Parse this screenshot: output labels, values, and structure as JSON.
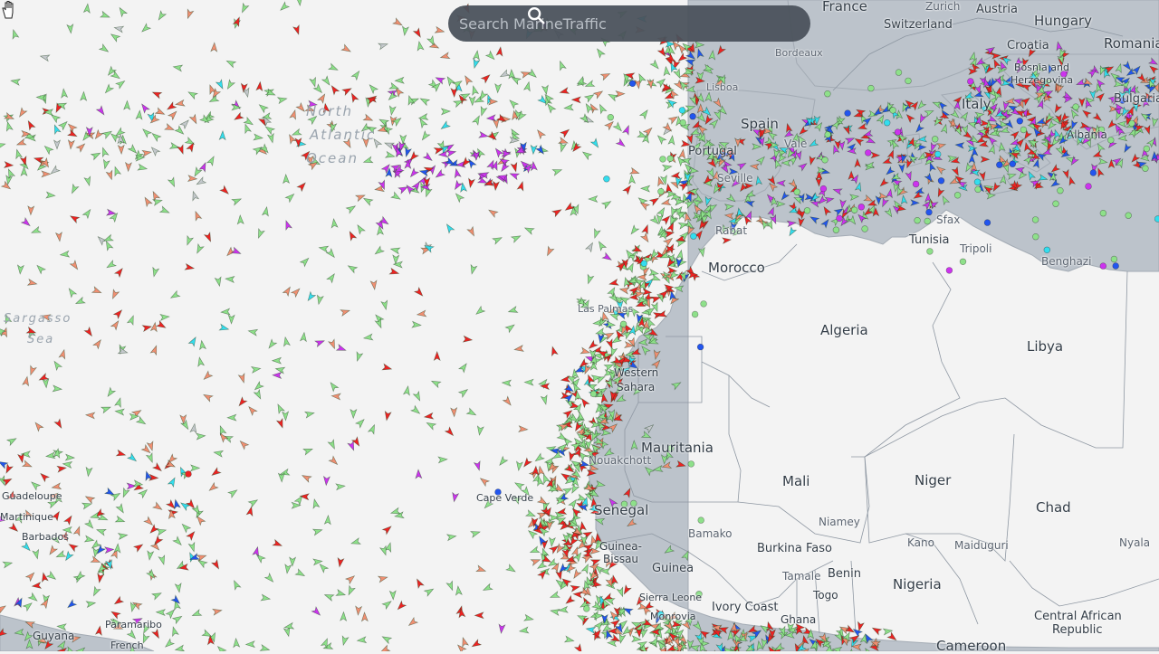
{
  "search": {
    "placeholder": "Search MarineTraffic"
  },
  "ocean_labels": {
    "north_atlantic_1": "North",
    "north_atlantic_2": "Atlantic",
    "north_atlantic_3": "Ocean",
    "sargasso_1": "Sargasso",
    "sargasso_2": "Sea"
  },
  "countries": {
    "france": "France",
    "switzerland": "Switzerland",
    "austria": "Austria",
    "hungary": "Hungary",
    "croatia": "Croatia",
    "romania": "Romania",
    "bosnia_1": "Bosnia and",
    "bosnia_2": "Herzegovina",
    "bulgaria": "Bulgaria",
    "italy": "Italy",
    "spain": "Spain",
    "portugal": "Portugal",
    "morocco": "Morocco",
    "algeria": "Algeria",
    "libya": "Libya",
    "tunisia": "Tunisia",
    "western_sahara_1": "Western",
    "western_sahara_2": "Sahara",
    "mauritania": "Mauritania",
    "mali": "Mali",
    "niger": "Niger",
    "chad": "Chad",
    "senegal": "Senegal",
    "guinea_bissau_1": "Guinea-",
    "guinea_bissau_2": "Bissau",
    "guinea": "Guinea",
    "sierra_leone": "Sierra Leone",
    "liberia": "Monrovia",
    "ivory_coast": "Ivory Coast",
    "ghana": "Ghana",
    "burkina_faso": "Burkina Faso",
    "benin": "Benin",
    "togo": "Togo",
    "nigeria": "Nigeria",
    "cameroon": "Cameroon",
    "car_1": "Central African",
    "car_2": "Republic",
    "guyana": "Guyana",
    "french": "French",
    "albania": "Albania",
    "cape_verde": "Cape Verde",
    "guadeloupe": "Guadeloupe",
    "martinique": "Martinique",
    "barbados": "Barbados",
    "paramaribo": "Paramaribo"
  },
  "cities": {
    "zurich": "Zurich",
    "valencia": "Vale",
    "seville": "Seville",
    "rabat": "Rabat",
    "las_palmas": "Las Palmas",
    "nouakchott": "Nouakchott",
    "bamako": "Bamako",
    "niamey": "Niamey",
    "kano": "Kano",
    "maiduguri": "Maiduguri",
    "tamale": "Tamale",
    "nyala": "Nyala",
    "benghazi": "Benghazi",
    "sfax": "Sfax",
    "tripoli": "Tripoli",
    "bordeaux": "Bordeaux",
    "lisboa": "Lisboa"
  },
  "colors": {
    "land": "#bcc3cb",
    "water": "#f3f3f3",
    "border": "#9aa3ad",
    "cargo": "#8ee08a",
    "tanker": "#ee2222",
    "tanker_light": "#f08f72",
    "passenger": "#cc33ee",
    "fishing": "#f6a082",
    "highspeed": "#33ddee",
    "tug": "#2255ee",
    "unknown": "#c4c8cc"
  }
}
